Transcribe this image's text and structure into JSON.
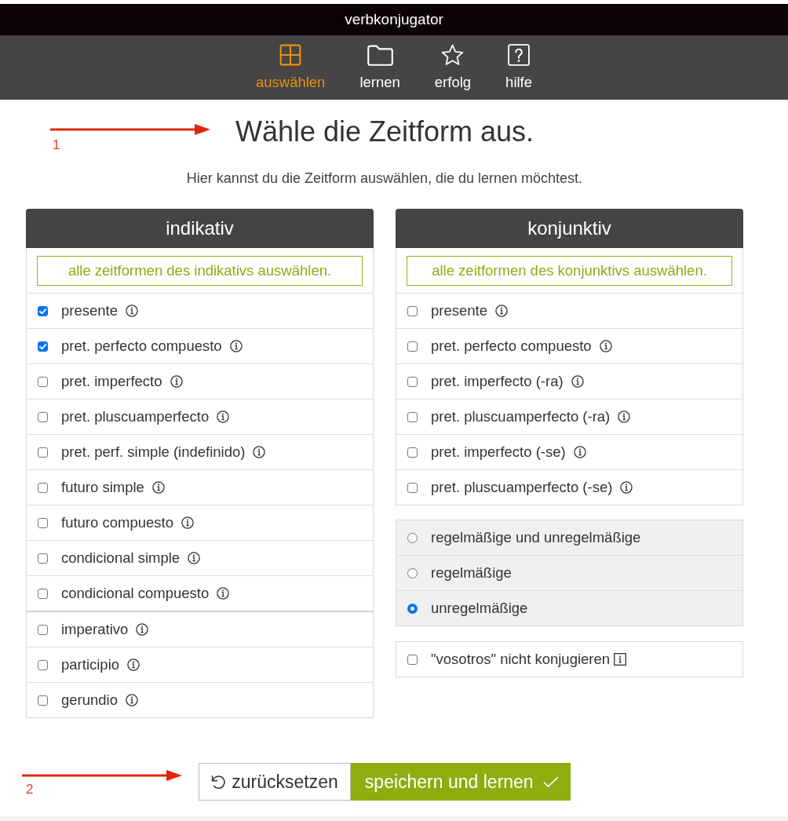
{
  "app_bar": {
    "title": "verbkonjugator"
  },
  "nav": [
    {
      "label": "auswählen",
      "selected": true
    },
    {
      "label": "lernen",
      "selected": false
    },
    {
      "label": "erfolg",
      "selected": false
    },
    {
      "label": "hilfe",
      "selected": false
    }
  ],
  "annotations": [
    {
      "label": "1"
    },
    {
      "label": "2"
    }
  ],
  "heading": "Wähle die Zeitform aus.",
  "intro": "Hier kannst du die Zeitform auswählen, die du lernen möchtest.",
  "indikativ": {
    "title": "indikativ",
    "select_all": "alle zeitformen des indikativs auswählen.",
    "groups": [
      {
        "items": [
          {
            "label": "presente",
            "checked": true
          },
          {
            "label": "pret. perfecto compuesto",
            "checked": true
          },
          {
            "label": "pret. imperfecto",
            "checked": false
          },
          {
            "label": "pret. pluscuamperfecto",
            "checked": false
          },
          {
            "label": "pret. perf. simple (indefinido)",
            "checked": false
          },
          {
            "label": "futuro simple",
            "checked": false
          },
          {
            "label": "futuro compuesto",
            "checked": false
          },
          {
            "label": "condicional simple",
            "checked": false
          },
          {
            "label": "condicional compuesto",
            "checked": false
          }
        ]
      },
      {
        "items": [
          {
            "label": "imperativo",
            "checked": false
          },
          {
            "label": "participio",
            "checked": false
          },
          {
            "label": "gerundio",
            "checked": false
          }
        ]
      }
    ]
  },
  "konjunktiv": {
    "title": "konjunktiv",
    "select_all": "alle zeitformen des konjunktivs auswählen.",
    "groups": [
      {
        "items": [
          {
            "label": "presente",
            "checked": false
          },
          {
            "label": "pret. perfecto compuesto",
            "checked": false
          },
          {
            "label": "pret. imperfecto (-ra)",
            "checked": false
          },
          {
            "label": "pret. pluscuamperfecto (-ra)",
            "checked": false
          },
          {
            "label": "pret. imperfecto (-se)",
            "checked": false
          },
          {
            "label": "pret. pluscuamperfecto (-se)",
            "checked": false
          }
        ]
      }
    ]
  },
  "verb_types": [
    {
      "label": "regelmäßige und unregelmäßige",
      "selected": false
    },
    {
      "label": "regelmäßige",
      "selected": false
    },
    {
      "label": "unregelmäßige",
      "selected": true
    }
  ],
  "vosotros": {
    "label": "\"vosotros\" nicht konjugieren",
    "checked": false
  },
  "buttons": [
    {
      "label": "zurücksetzen",
      "kind": "reset"
    },
    {
      "label": "speichern und lernen",
      "kind": "primary"
    }
  ]
}
